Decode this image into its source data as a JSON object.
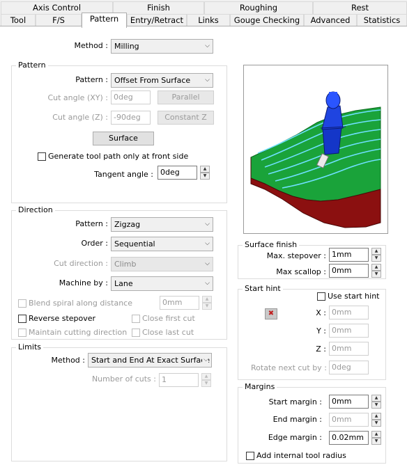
{
  "tabs_top": [
    "Axis Control",
    "Finish",
    "Roughing",
    "Rest"
  ],
  "tabs_bottom": [
    "Tool",
    "F/S",
    "Pattern",
    "Entry/Retract",
    "Links",
    "Gouge Checking",
    "Advanced",
    "Statistics"
  ],
  "method": {
    "label": "Method :",
    "value": "Milling"
  },
  "pattern_group": {
    "title": "Pattern",
    "pattern_label": "Pattern :",
    "pattern_value": "Offset From Surface",
    "cut_angle_xy_label": "Cut angle (XY) :",
    "cut_angle_xy": "0deg",
    "parallel_btn": "Parallel",
    "cut_angle_z_label": "Cut angle (Z) :",
    "cut_angle_z": "-90deg",
    "constant_z_btn": "Constant Z",
    "surface_btn": "Surface",
    "front_side_label": "Generate tool path only at front side",
    "tangent_label": "Tangent angle :",
    "tangent_value": "0deg"
  },
  "direction_group": {
    "title": "Direction",
    "pattern_label": "Pattern :",
    "pattern_value": "Zigzag",
    "order_label": "Order :",
    "order_value": "Sequential",
    "cut_dir_label": "Cut direction :",
    "cut_dir_value": "Climb",
    "machine_by_label": "Machine by :",
    "machine_by_value": "Lane",
    "blend_label": "Blend spiral along distance",
    "blend_value": "0mm",
    "reverse_label": "Reverse stepover",
    "close_first_label": "Close first cut",
    "maintain_label": "Maintain cutting direction",
    "close_last_label": "Close last cut"
  },
  "limits_group": {
    "title": "Limits",
    "method_label": "Method :",
    "method_value": "Start and End At Exact Surface E",
    "num_cuts_label": "Number of cuts :",
    "num_cuts_value": "1"
  },
  "surface_finish": {
    "title": "Surface finish",
    "max_stepover_label": "Max. stepover :",
    "max_stepover": "1mm",
    "max_scallop_label": "Max scallop :",
    "max_scallop": "0mm"
  },
  "start_hint": {
    "title": "Start hint",
    "use_label": "Use start hint",
    "x_label": "X :",
    "x": "0mm",
    "y_label": "Y :",
    "y": "0mm",
    "z_label": "Z :",
    "z": "0mm",
    "rotate_label": "Rotate next cut by :",
    "rotate": "0deg"
  },
  "margins": {
    "title": "Margins",
    "start_label": "Start margin :",
    "start": "0mm",
    "end_label": "End margin :",
    "end": "0mm",
    "edge_label": "Edge margin :",
    "edge": "0.02mm",
    "add_radius_label": "Add internal tool radius"
  }
}
